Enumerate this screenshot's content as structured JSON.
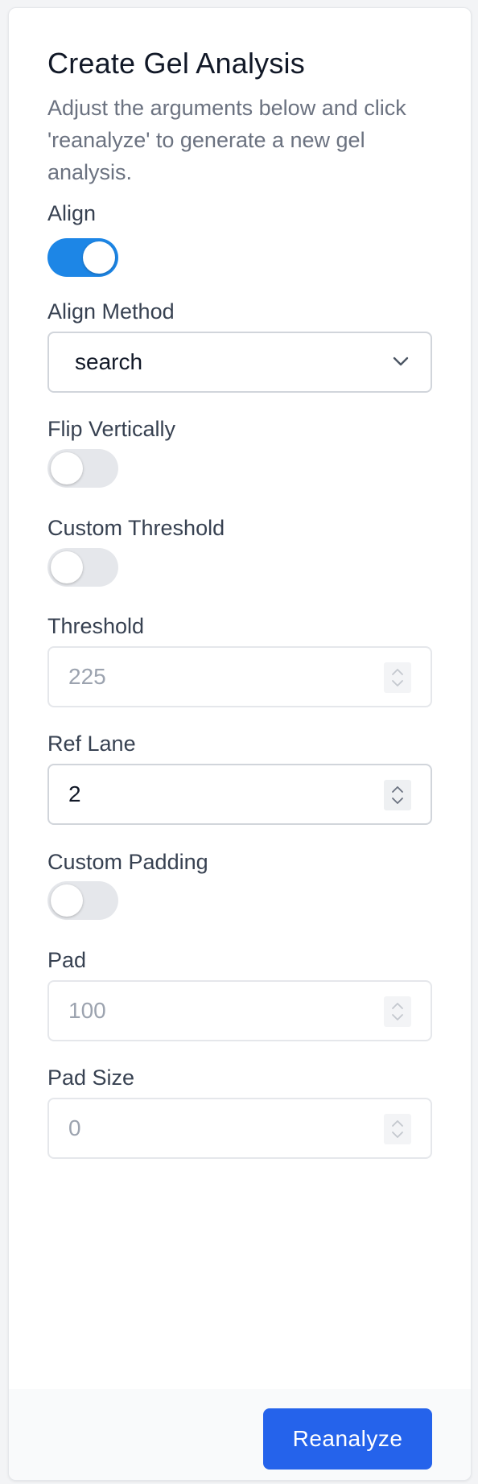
{
  "form": {
    "title": "Create Gel Analysis",
    "description": "Adjust the arguments below and click 'reanalyze' to generate a new gel analysis."
  },
  "fields": {
    "align": {
      "label": "Align",
      "checked": true
    },
    "align_method": {
      "label": "Align Method",
      "value": "search"
    },
    "flip_vertically": {
      "label": "Flip Vertically",
      "checked": false
    },
    "custom_threshold": {
      "label": "Custom Threshold",
      "checked": false
    },
    "threshold": {
      "label": "Threshold",
      "value": "225",
      "disabled": true
    },
    "ref_lane": {
      "label": "Ref Lane",
      "value": "2",
      "disabled": false
    },
    "custom_padding": {
      "label": "Custom Padding",
      "checked": false
    },
    "pad": {
      "label": "Pad",
      "value": "100",
      "disabled": true
    },
    "pad_size": {
      "label": "Pad Size",
      "value": "0",
      "disabled": true
    }
  },
  "footer": {
    "reanalyze_label": "Reanalyze"
  },
  "colors": {
    "toggle_on": "#1d86e6",
    "toggle_off": "#e5e7eb",
    "primary_button": "#2563eb"
  },
  "icons": {
    "select_arrow": "chevron-down-icon",
    "number_spinner": "spinner-arrows-icon"
  }
}
